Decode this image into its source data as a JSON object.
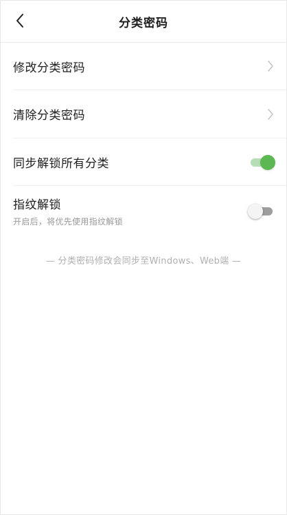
{
  "header": {
    "title": "分类密码",
    "back_icon": "chevron-left-icon"
  },
  "settings": [
    {
      "label": "修改分类密码",
      "type": "link",
      "icon": "chevron-right-icon"
    },
    {
      "label": "清除分类密码",
      "type": "link",
      "icon": "chevron-right-icon"
    },
    {
      "label": "同步解锁所有分类",
      "type": "toggle",
      "enabled": true
    },
    {
      "label": "指纹解锁",
      "sublabel": "开启后，将优先使用指纹解锁",
      "type": "toggle",
      "enabled": false
    }
  ],
  "note": "— 分类密码修改会同步至Windows、Web端 —",
  "colors": {
    "toggle_on": "#5bb853",
    "toggle_on_track": "#b7ddb6",
    "toggle_off_track": "#9e9e9e"
  }
}
